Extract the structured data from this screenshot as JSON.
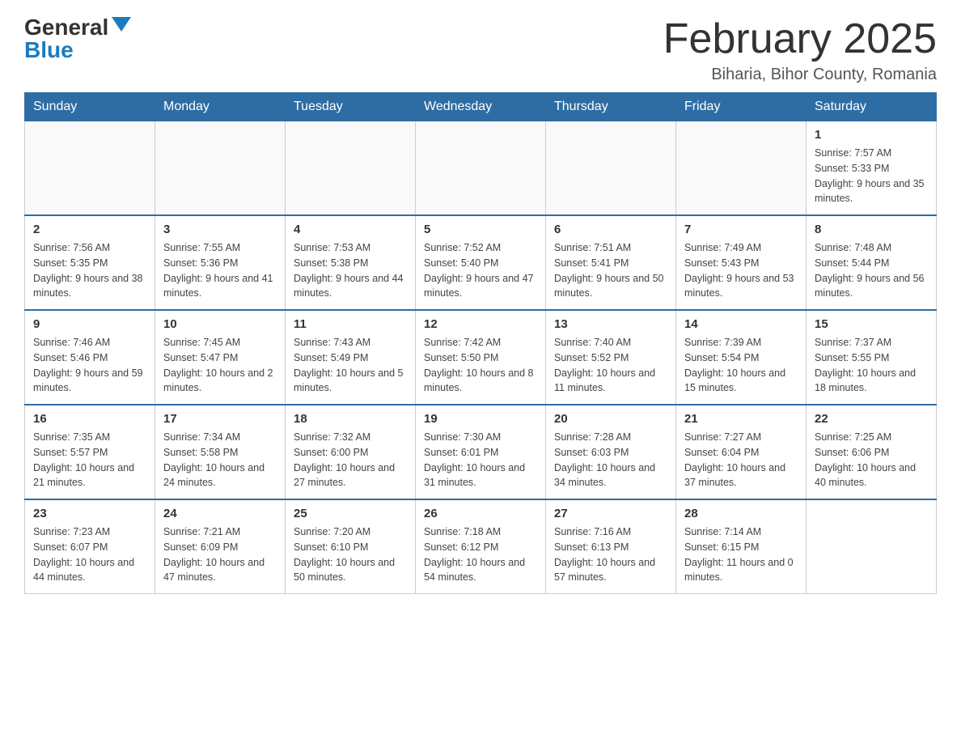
{
  "header": {
    "logo_general": "General",
    "logo_blue": "Blue",
    "title": "February 2025",
    "location": "Biharia, Bihor County, Romania"
  },
  "weekdays": [
    "Sunday",
    "Monday",
    "Tuesday",
    "Wednesday",
    "Thursday",
    "Friday",
    "Saturday"
  ],
  "weeks": [
    [
      {
        "day": "",
        "info": ""
      },
      {
        "day": "",
        "info": ""
      },
      {
        "day": "",
        "info": ""
      },
      {
        "day": "",
        "info": ""
      },
      {
        "day": "",
        "info": ""
      },
      {
        "day": "",
        "info": ""
      },
      {
        "day": "1",
        "info": "Sunrise: 7:57 AM\nSunset: 5:33 PM\nDaylight: 9 hours and 35 minutes."
      }
    ],
    [
      {
        "day": "2",
        "info": "Sunrise: 7:56 AM\nSunset: 5:35 PM\nDaylight: 9 hours and 38 minutes."
      },
      {
        "day": "3",
        "info": "Sunrise: 7:55 AM\nSunset: 5:36 PM\nDaylight: 9 hours and 41 minutes."
      },
      {
        "day": "4",
        "info": "Sunrise: 7:53 AM\nSunset: 5:38 PM\nDaylight: 9 hours and 44 minutes."
      },
      {
        "day": "5",
        "info": "Sunrise: 7:52 AM\nSunset: 5:40 PM\nDaylight: 9 hours and 47 minutes."
      },
      {
        "day": "6",
        "info": "Sunrise: 7:51 AM\nSunset: 5:41 PM\nDaylight: 9 hours and 50 minutes."
      },
      {
        "day": "7",
        "info": "Sunrise: 7:49 AM\nSunset: 5:43 PM\nDaylight: 9 hours and 53 minutes."
      },
      {
        "day": "8",
        "info": "Sunrise: 7:48 AM\nSunset: 5:44 PM\nDaylight: 9 hours and 56 minutes."
      }
    ],
    [
      {
        "day": "9",
        "info": "Sunrise: 7:46 AM\nSunset: 5:46 PM\nDaylight: 9 hours and 59 minutes."
      },
      {
        "day": "10",
        "info": "Sunrise: 7:45 AM\nSunset: 5:47 PM\nDaylight: 10 hours and 2 minutes."
      },
      {
        "day": "11",
        "info": "Sunrise: 7:43 AM\nSunset: 5:49 PM\nDaylight: 10 hours and 5 minutes."
      },
      {
        "day": "12",
        "info": "Sunrise: 7:42 AM\nSunset: 5:50 PM\nDaylight: 10 hours and 8 minutes."
      },
      {
        "day": "13",
        "info": "Sunrise: 7:40 AM\nSunset: 5:52 PM\nDaylight: 10 hours and 11 minutes."
      },
      {
        "day": "14",
        "info": "Sunrise: 7:39 AM\nSunset: 5:54 PM\nDaylight: 10 hours and 15 minutes."
      },
      {
        "day": "15",
        "info": "Sunrise: 7:37 AM\nSunset: 5:55 PM\nDaylight: 10 hours and 18 minutes."
      }
    ],
    [
      {
        "day": "16",
        "info": "Sunrise: 7:35 AM\nSunset: 5:57 PM\nDaylight: 10 hours and 21 minutes."
      },
      {
        "day": "17",
        "info": "Sunrise: 7:34 AM\nSunset: 5:58 PM\nDaylight: 10 hours and 24 minutes."
      },
      {
        "day": "18",
        "info": "Sunrise: 7:32 AM\nSunset: 6:00 PM\nDaylight: 10 hours and 27 minutes."
      },
      {
        "day": "19",
        "info": "Sunrise: 7:30 AM\nSunset: 6:01 PM\nDaylight: 10 hours and 31 minutes."
      },
      {
        "day": "20",
        "info": "Sunrise: 7:28 AM\nSunset: 6:03 PM\nDaylight: 10 hours and 34 minutes."
      },
      {
        "day": "21",
        "info": "Sunrise: 7:27 AM\nSunset: 6:04 PM\nDaylight: 10 hours and 37 minutes."
      },
      {
        "day": "22",
        "info": "Sunrise: 7:25 AM\nSunset: 6:06 PM\nDaylight: 10 hours and 40 minutes."
      }
    ],
    [
      {
        "day": "23",
        "info": "Sunrise: 7:23 AM\nSunset: 6:07 PM\nDaylight: 10 hours and 44 minutes."
      },
      {
        "day": "24",
        "info": "Sunrise: 7:21 AM\nSunset: 6:09 PM\nDaylight: 10 hours and 47 minutes."
      },
      {
        "day": "25",
        "info": "Sunrise: 7:20 AM\nSunset: 6:10 PM\nDaylight: 10 hours and 50 minutes."
      },
      {
        "day": "26",
        "info": "Sunrise: 7:18 AM\nSunset: 6:12 PM\nDaylight: 10 hours and 54 minutes."
      },
      {
        "day": "27",
        "info": "Sunrise: 7:16 AM\nSunset: 6:13 PM\nDaylight: 10 hours and 57 minutes."
      },
      {
        "day": "28",
        "info": "Sunrise: 7:14 AM\nSunset: 6:15 PM\nDaylight: 11 hours and 0 minutes."
      },
      {
        "day": "",
        "info": ""
      }
    ]
  ]
}
